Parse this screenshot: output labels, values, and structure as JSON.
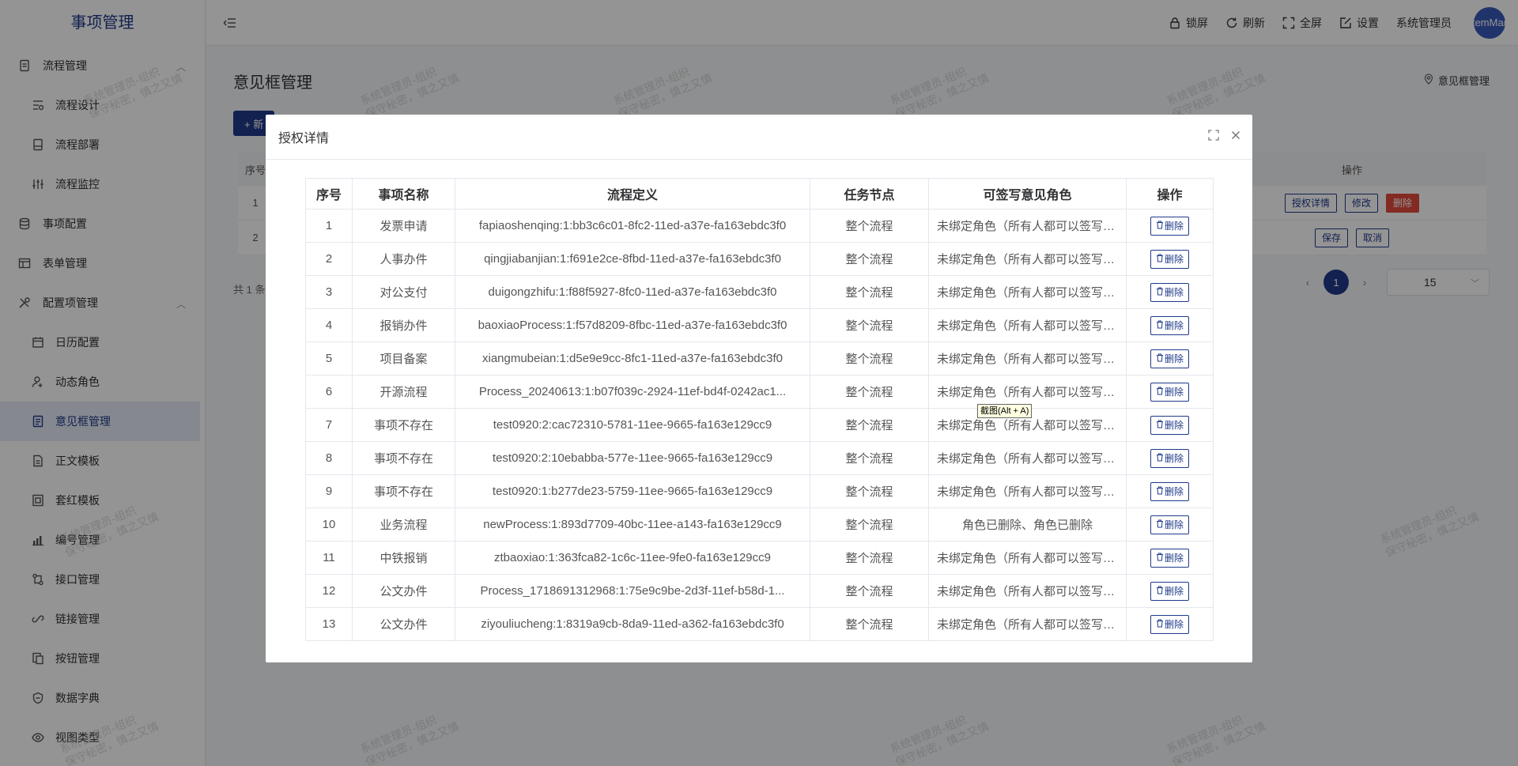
{
  "app": {
    "title": "事项管理"
  },
  "sidebar": {
    "groups": [
      {
        "label": "流程管理",
        "icon": "document-icon"
      },
      {
        "label": "事项配置",
        "icon": "database-icon"
      },
      {
        "label": "表单管理",
        "icon": "table-icon"
      },
      {
        "label": "配置项管理",
        "icon": "tools-icon"
      }
    ],
    "flow_items": [
      {
        "label": "流程设计",
        "icon": "flow-design-icon"
      },
      {
        "label": "流程部署",
        "icon": "deploy-icon"
      },
      {
        "label": "流程监控",
        "icon": "monitor-icon"
      }
    ],
    "config_items": [
      {
        "label": "日历配置",
        "icon": "calendar-icon"
      },
      {
        "label": "动态角色",
        "icon": "user-icon"
      },
      {
        "label": "意见框管理",
        "icon": "opinion-icon",
        "active": true
      },
      {
        "label": "正文模板",
        "icon": "doc-template-icon"
      },
      {
        "label": "套红模板",
        "icon": "red-template-icon"
      },
      {
        "label": "编号管理",
        "icon": "number-icon"
      },
      {
        "label": "接口管理",
        "icon": "api-icon"
      },
      {
        "label": "链接管理",
        "icon": "link-icon"
      },
      {
        "label": "按钮管理",
        "icon": "button-icon"
      },
      {
        "label": "数据字典",
        "icon": "dictionary-icon"
      },
      {
        "label": "视图类型",
        "icon": "eye-icon"
      }
    ]
  },
  "header": {
    "lock": "锁屏",
    "refresh": "刷新",
    "fullscreen": "全屏",
    "settings": "设置",
    "user": "系统管理员",
    "avatar_text": "temMar"
  },
  "page": {
    "title": "意见框管理",
    "breadcrumb": "意见框管理",
    "add_button": "+ 新",
    "table_head_index": "序号",
    "table_head_op": "操作",
    "rows": [
      {
        "index": "1",
        "buttons": [
          "授权详情",
          "修改",
          "删除"
        ]
      },
      {
        "index": "2",
        "buttons": [
          "保存",
          "取消"
        ]
      }
    ],
    "total_text": "共 1 条",
    "current_page": "1",
    "page_size": "15"
  },
  "watermark": {
    "line1": "系统管理员-组织",
    "line2": "保守秘密，慎之又慎"
  },
  "modal": {
    "title": "授权详情",
    "columns": [
      "序号",
      "事项名称",
      "流程定义",
      "任务节点",
      "可签写意见角色",
      "操作"
    ],
    "delete_label": "删除",
    "rows": [
      {
        "index": "1",
        "name": "发票申请",
        "definition": "fapiaoshenqing:1:bb3c6c01-8fc2-11ed-a37e-fa163ebdc3f0",
        "node": "整个流程",
        "role": "未绑定角色（所有人都可以签写意见）"
      },
      {
        "index": "2",
        "name": "人事办件",
        "definition": "qingjiabanjian:1:f691e2ce-8fbd-11ed-a37e-fa163ebdc3f0",
        "node": "整个流程",
        "role": "未绑定角色（所有人都可以签写意见）"
      },
      {
        "index": "3",
        "name": "对公支付",
        "definition": "duigongzhifu:1:f88f5927-8fc0-11ed-a37e-fa163ebdc3f0",
        "node": "整个流程",
        "role": "未绑定角色（所有人都可以签写意见）"
      },
      {
        "index": "4",
        "name": "报销办件",
        "definition": "baoxiaoProcess:1:f57d8209-8fbc-11ed-a37e-fa163ebdc3f0",
        "node": "整个流程",
        "role": "未绑定角色（所有人都可以签写意见）"
      },
      {
        "index": "5",
        "name": "项目备案",
        "definition": "xiangmubeian:1:d5e9e9cc-8fc1-11ed-a37e-fa163ebdc3f0",
        "node": "整个流程",
        "role": "未绑定角色（所有人都可以签写意见）"
      },
      {
        "index": "6",
        "name": "开源流程",
        "definition": "Process_20240613:1:b07f039c-2924-11ef-bd4f-0242ac1...",
        "node": "整个流程",
        "role": "未绑定角色（所有人都可以签写意见）"
      },
      {
        "index": "7",
        "name": "事项不存在",
        "definition": "test0920:2:cac72310-5781-11ee-9665-fa163e129cc9",
        "node": "整个流程",
        "role": "未绑定角色（所有人都可以签写意见）"
      },
      {
        "index": "8",
        "name": "事项不存在",
        "definition": "test0920:2:10ebabba-577e-11ee-9665-fa163e129cc9",
        "node": "整个流程",
        "role": "未绑定角色（所有人都可以签写意见）"
      },
      {
        "index": "9",
        "name": "事项不存在",
        "definition": "test0920:1:b277de23-5759-11ee-9665-fa163e129cc9",
        "node": "整个流程",
        "role": "未绑定角色（所有人都可以签写意见）"
      },
      {
        "index": "10",
        "name": "业务流程",
        "definition": "newProcess:1:893d7709-40bc-11ee-a143-fa163e129cc9",
        "node": "整个流程",
        "role": "角色已删除、角色已删除"
      },
      {
        "index": "11",
        "name": "中铁报销",
        "definition": "ztbaoxiao:1:363fca82-1c6c-11ee-9fe0-fa163e129cc9",
        "node": "整个流程",
        "role": "未绑定角色（所有人都可以签写意见）"
      },
      {
        "index": "12",
        "name": "公文办件",
        "definition": "Process_1718691312968:1:75e9c9be-2d3f-11ef-b58d-1...",
        "node": "整个流程",
        "role": "未绑定角色（所有人都可以签写意见）"
      },
      {
        "index": "13",
        "name": "公文办件",
        "definition": "ziyouliucheng:1:8319a9cb-8da9-11ed-a362-fa163ebdc3f0",
        "node": "整个流程",
        "role": "未绑定角色（所有人都可以签写意见）"
      }
    ]
  },
  "tooltip": {
    "text": "截图(Alt + A)"
  }
}
